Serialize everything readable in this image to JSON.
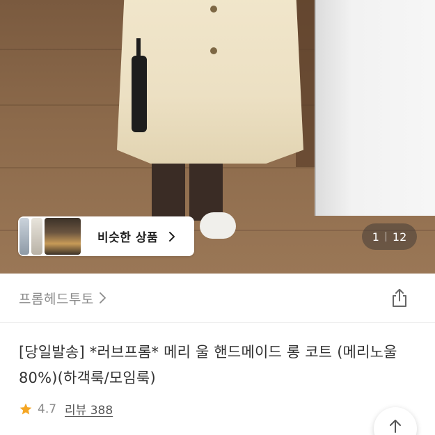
{
  "gallery": {
    "similar_products_label": "비슷한 상품",
    "current_index": "1",
    "total_count": "12"
  },
  "shop": {
    "name": "프롬헤드투토"
  },
  "product": {
    "title": "[당일발송] *러브프롬* 메리 울 핸드메이드 롱 코트 (메리노울 80%)(하객룩/모임룩)",
    "rating": "4.7",
    "review_label": "리뷰 388"
  },
  "icons": {
    "share": "share-icon",
    "star": "star-icon",
    "scroll_top": "arrow-up-icon",
    "chevron": "chevron-right-icon"
  },
  "colors": {
    "star": "#f5a623",
    "muted_text": "#8a8a8a"
  }
}
